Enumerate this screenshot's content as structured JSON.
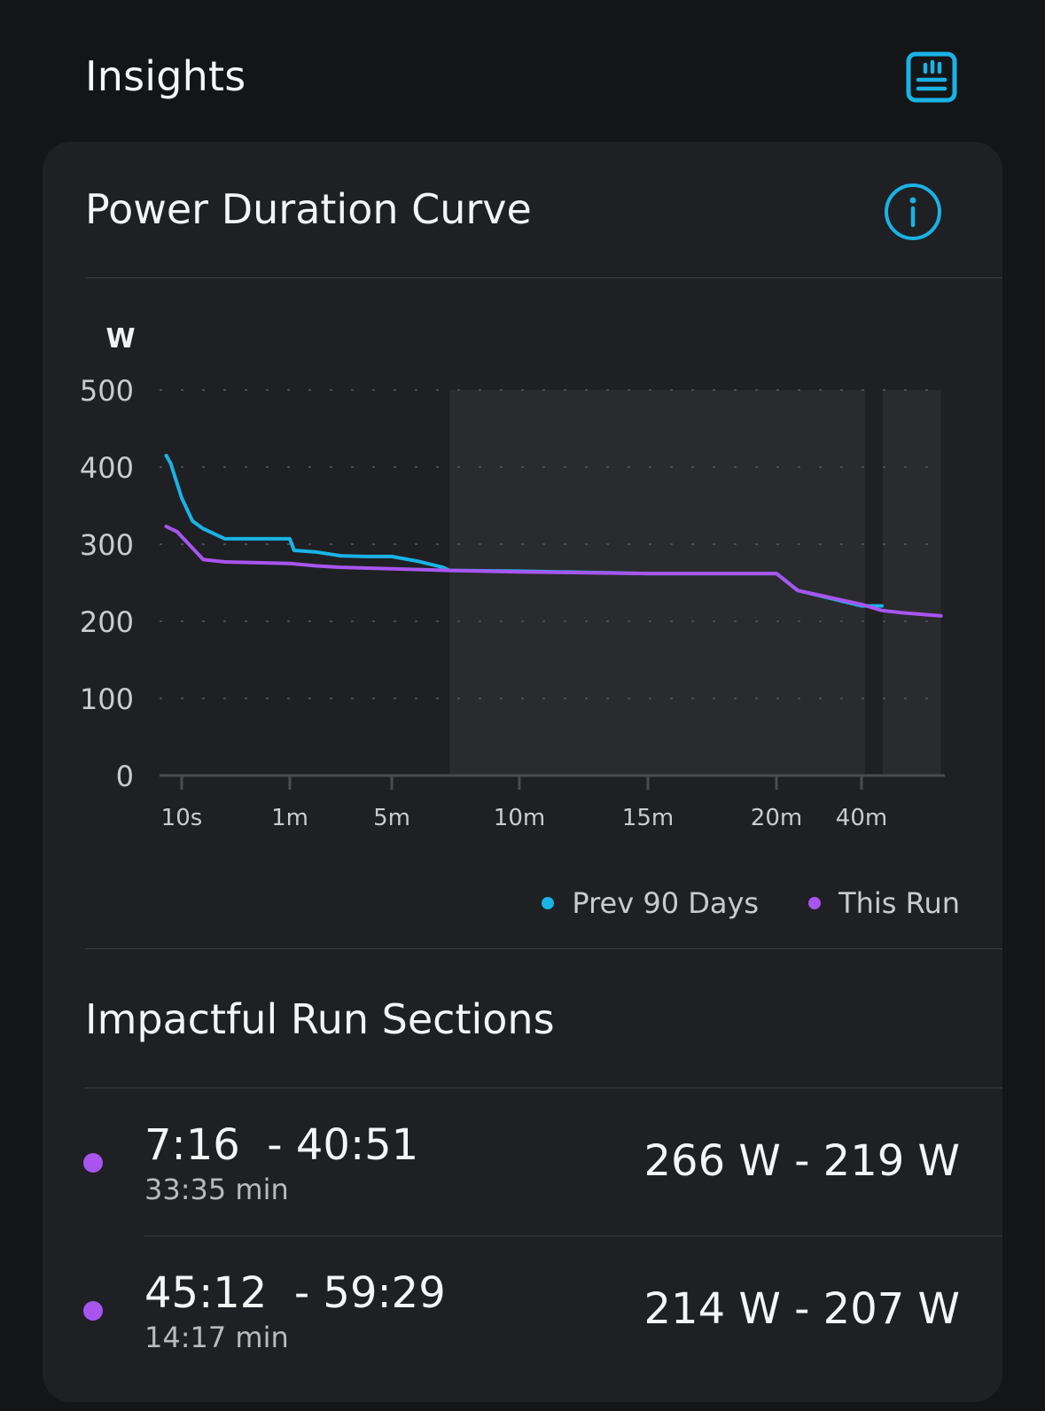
{
  "header": {
    "title": "Insights",
    "report_icon": "report-list-icon"
  },
  "card": {
    "title": "Power Duration Curve",
    "info_icon": "info-icon"
  },
  "chart_data": {
    "type": "line",
    "ylabel": "W",
    "ylim": [
      0,
      500
    ],
    "yticks": [
      "500",
      "400",
      "300",
      "200",
      "100",
      "0"
    ],
    "xticks": [
      "10s",
      "1m",
      "5m",
      "10m",
      "15m",
      "20m",
      "40m"
    ],
    "grid": true,
    "legend_position": "bottom-right",
    "highlighted_ranges": [
      {
        "from": "7:16",
        "to": "40:51"
      },
      {
        "from": "45:12",
        "to": "59:29"
      }
    ],
    "series": [
      {
        "name": "Prev 90 Days",
        "color": "#1ab3e6",
        "x": [
          "3s",
          "5s",
          "10s",
          "15s",
          "20s",
          "30s",
          "45s",
          "1m",
          "1m10s",
          "2m",
          "3m",
          "4m",
          "5m",
          "6m",
          "7m",
          "7:16",
          "10m",
          "15m",
          "20m",
          "25m",
          "40m",
          "45m"
        ],
        "values": [
          415,
          405,
          360,
          330,
          320,
          307,
          307,
          307,
          292,
          290,
          285,
          284,
          284,
          278,
          270,
          266,
          265,
          262,
          262,
          240,
          220,
          220
        ]
      },
      {
        "name": "This Run",
        "color": "#a855f0",
        "x": [
          "3s",
          "8s",
          "20s",
          "30s",
          "1m",
          "2m",
          "3m",
          "5m",
          "7:16",
          "10m",
          "15m",
          "20m",
          "25m",
          "40m",
          "45m",
          "50m",
          "59:29"
        ],
        "values": [
          323,
          316,
          280,
          277,
          275,
          272,
          270,
          268,
          266,
          264,
          262,
          262,
          240,
          222,
          214,
          211,
          207
        ]
      }
    ]
  },
  "legend": [
    {
      "label": "Prev 90 Days",
      "color": "#1ab3e6"
    },
    {
      "label": "This Run",
      "color": "#a855f0"
    }
  ],
  "sections": {
    "title": "Impactful Run Sections",
    "items": [
      {
        "range": "7:16  - 40:51",
        "duration": "33:35 min",
        "power": "266 W - 219 W",
        "color": "#a855f0"
      },
      {
        "range": "45:12  - 59:29",
        "duration": "14:17 min",
        "power": "214 W - 207 W",
        "color": "#a855f0"
      }
    ]
  }
}
